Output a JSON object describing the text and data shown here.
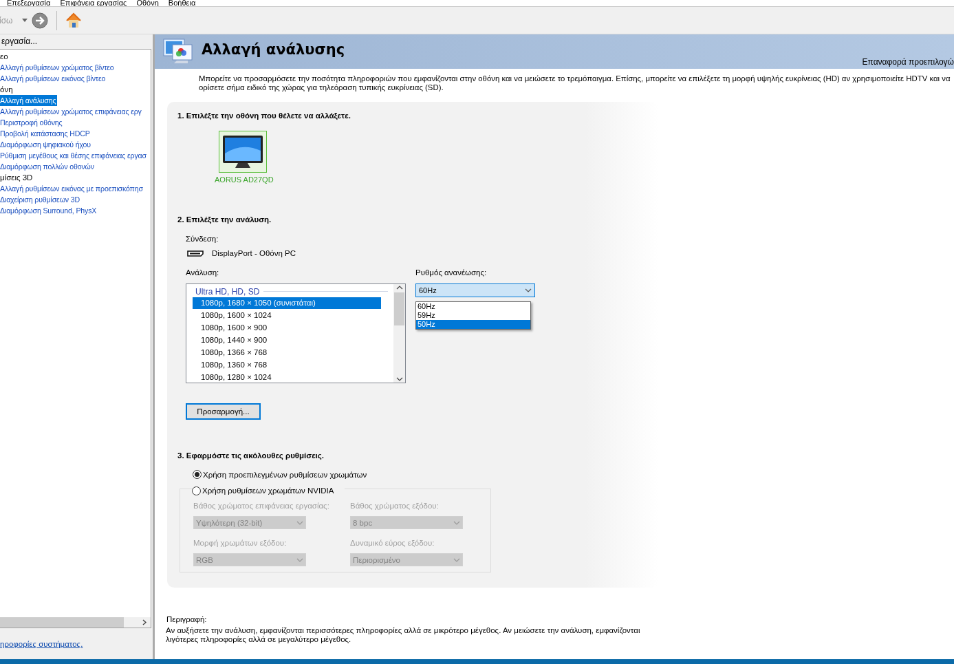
{
  "menu_bar": [
    "Επεξεργασία",
    "Επιφάνεια εργασίας",
    "Οθόνη",
    "Βοήθεια"
  ],
  "toolbar": {
    "back_label": "ίσω"
  },
  "sidebar": {
    "title": "εργασία...",
    "tree": [
      {
        "label": "εο",
        "children": [
          {
            "label": "Αλλαγή ρυθμίσεων χρώματος βίντεο",
            "selected": false
          },
          {
            "label": "Αλλαγή ρυθμίσεων εικόνας βίντεο",
            "selected": false
          }
        ]
      },
      {
        "label": "όνη",
        "children": [
          {
            "label": "Αλλαγή ανάλυσης",
            "selected": true
          },
          {
            "label": "Αλλαγή ρυθμίσεων χρώματος επιφάνειας εργ",
            "selected": false
          },
          {
            "label": "Περιστροφή οθόνης",
            "selected": false
          },
          {
            "label": "Προβολή κατάστασης HDCP",
            "selected": false
          },
          {
            "label": "Διαμόρφωση ψηφιακού ήχου",
            "selected": false
          },
          {
            "label": "Ρύθμιση μεγέθους και θέσης επιφάνειας εργασ",
            "selected": false
          },
          {
            "label": "Διαμόρφωση πολλών οθονών",
            "selected": false
          }
        ]
      },
      {
        "label": "μίσεις 3D",
        "children": [
          {
            "label": "Αλλαγή ρυθμίσεων εικόνας με προεπισκόπησ",
            "selected": false
          },
          {
            "label": "Διαχείριση ρυθμίσεων 3D",
            "selected": false
          },
          {
            "label": "Διαμόρφωση Surround, PhysX",
            "selected": false
          }
        ]
      }
    ],
    "footer_link": "ηροφορίες συστήματος."
  },
  "page": {
    "title": "Αλλαγή ανάλυσης",
    "reset_link": "Επαναφορά προεπιλογώ",
    "intro": [
      "Μπορείτε να προσαρμόσετε την ποσότητα πληροφοριών που εμφανίζονται στην οθόνη και να μειώσετε το τρεμόπαιγμα. Επίσης, μπορείτε να επιλέξετε τη μορφή υψηλής ευκρίνειας (HD) αν χρησιμοποιείτε HDTV και να",
      "ορίσετε σήμα ειδικό της χώρας για τηλεόραση τυπικής ευκρίνειας (SD)."
    ]
  },
  "step1": {
    "heading": "1. Επιλέξτε την οθόνη που θέλετε να αλλάξετε.",
    "displays": [
      {
        "name": "AORUS AD27QD",
        "selected": true
      }
    ]
  },
  "step2": {
    "heading": "2. Επιλέξτε την ανάλυση.",
    "connection_label": "Σύνδεση:",
    "connection": "DisplayPort - Οθόνη PC",
    "resolution_label": "Ανάλυση:",
    "resolution_group": "Ultra HD, HD, SD",
    "resolutions": [
      {
        "label": "1080p, 1680 × 1050 (συνιστάται)",
        "selected": true
      },
      {
        "label": "1080p, 1600 × 1024",
        "selected": false
      },
      {
        "label": "1080p, 1600 × 900",
        "selected": false
      },
      {
        "label": "1080p, 1440 × 900",
        "selected": false
      },
      {
        "label": "1080p, 1366 × 768",
        "selected": false
      },
      {
        "label": "1080p, 1360 × 768",
        "selected": false
      },
      {
        "label": "1080p, 1280 × 1024",
        "selected": false
      }
    ],
    "refresh_label": "Ρυθμός ανανέωσης:",
    "refresh_value": "60Hz",
    "refresh_expanded": true,
    "refresh_options": [
      {
        "label": "60Hz",
        "selected": false
      },
      {
        "label": "59Hz",
        "selected": false
      },
      {
        "label": "50Hz",
        "selected": true
      }
    ],
    "customize_button": "Προσαρμογή..."
  },
  "step3": {
    "heading": "3. Εφαρμόστε τις ακόλουθες ρυθμίσεις.",
    "options": [
      {
        "label": "Χρήση προεπιλεγμένων ρυθμίσεων χρωμάτων",
        "selected": true
      },
      {
        "label": "Χρήση ρυθμίσεων χρωμάτων NVIDIA",
        "selected": false
      }
    ],
    "fields": [
      {
        "label": "Βάθος χρώματος επιφάνειας εργασίας:",
        "value": "Υψηλότερη (32-bit)",
        "disabled": true
      },
      {
        "label": "Βάθος χρώματος εξόδου:",
        "value": "8 bpc",
        "disabled": true
      },
      {
        "label": "Μορφή χρωμάτων εξόδου:",
        "value": "RGB",
        "disabled": true
      },
      {
        "label": "Δυναμικό εύρος εξόδου:",
        "value": "Περιορισμένο",
        "disabled": true
      }
    ]
  },
  "description": {
    "label": "Περιγραφή:",
    "text": "Αν αυξήσετε την ανάλυση, εμφανίζονται περισσότερες πληροφορίες αλλά σε μικρότερο μέγεθος. Αν μειώσετε την ανάλυση, εμφανίζονται λιγότερες πληροφορίες αλλά σε μεγαλύτερο μέγεθος."
  }
}
